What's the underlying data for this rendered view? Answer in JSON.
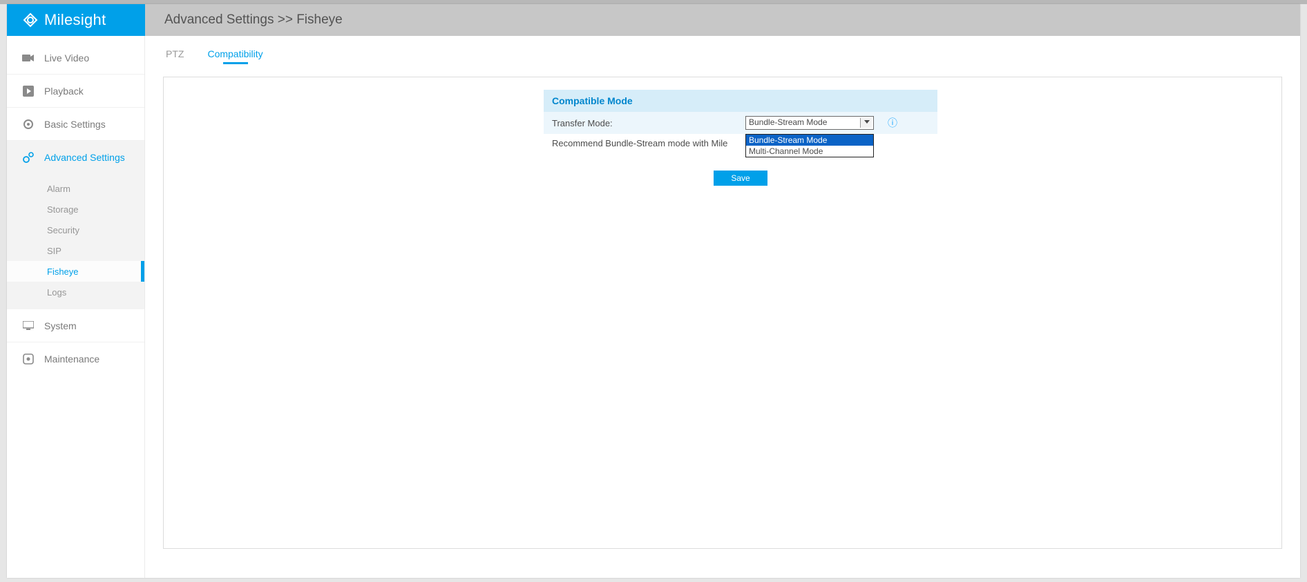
{
  "brand": "Milesight",
  "breadcrumb": "Advanced Settings >> Fisheye",
  "sidebar": {
    "live_video": "Live Video",
    "playback": "Playback",
    "basic_settings": "Basic Settings",
    "advanced_settings": "Advanced Settings",
    "system": "System",
    "maintenance": "Maintenance",
    "sub": {
      "alarm": "Alarm",
      "storage": "Storage",
      "security": "Security",
      "sip": "SIP",
      "fisheye": "Fisheye",
      "logs": "Logs"
    }
  },
  "tabs": {
    "ptz": "PTZ",
    "compatibility": "Compatibility"
  },
  "section": {
    "title": "Compatible Mode",
    "transfer_label": "Transfer Mode:",
    "transfer_value": "Bundle-Stream Mode",
    "options": {
      "bundle": "Bundle-Stream Mode",
      "multi": "Multi-Channel Mode"
    },
    "recommend": "Recommend Bundle-Stream mode with Mile",
    "save": "Save"
  }
}
